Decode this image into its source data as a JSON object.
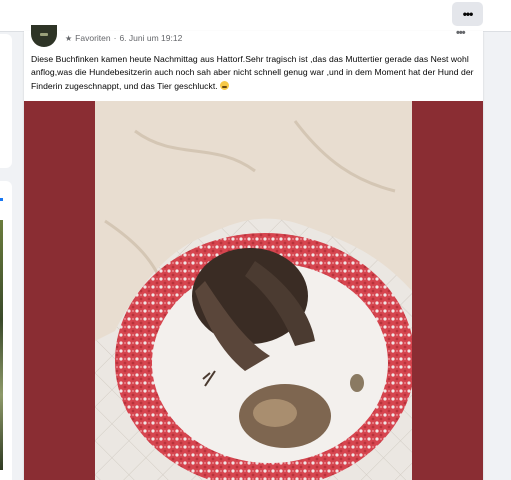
{
  "topbar": {
    "more_label": "•••"
  },
  "post": {
    "group": "Favoriten",
    "separator": "·",
    "timestamp": "6. Juni um 19:12",
    "more_label": "•••",
    "text": "Diese Buchfinken kamen heute Nachmittag aus Hattorf.Sehr tragisch ist ,das das Muttertier gerade das Nest wohl anflog,was die Hundebesitzerin auch noch sah aber nicht schnell genug war ,und in dem Moment  hat der Hund der Finderin zugeschnappt, und das Tier geschluckt.",
    "emoji": "sad-face-emoji"
  },
  "colors": {
    "photo_background": "#8a2d33",
    "crochet_red": "#d6454f",
    "towel": "#e8ddd0"
  }
}
